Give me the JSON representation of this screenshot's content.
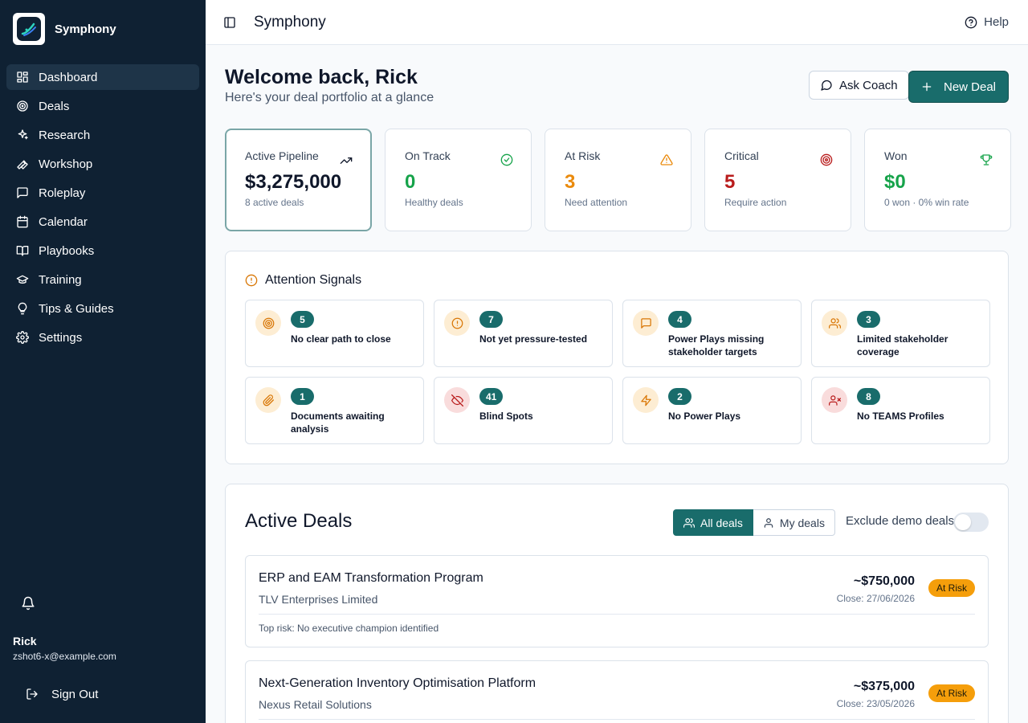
{
  "app": {
    "name": "Symphony"
  },
  "sidebar": {
    "items": [
      {
        "label": "Dashboard",
        "icon": "dashboard-icon"
      },
      {
        "label": "Deals",
        "icon": "target-icon"
      },
      {
        "label": "Research",
        "icon": "sparkles-icon"
      },
      {
        "label": "Workshop",
        "icon": "wrench-icon"
      },
      {
        "label": "Roleplay",
        "icon": "message-square-icon"
      },
      {
        "label": "Calendar",
        "icon": "calendar-icon"
      },
      {
        "label": "Playbooks",
        "icon": "book-icon"
      },
      {
        "label": "Training",
        "icon": "graduation-cap-icon"
      },
      {
        "label": "Tips & Guides",
        "icon": "lightbulb-icon"
      },
      {
        "label": "Settings",
        "icon": "gear-icon"
      }
    ],
    "active_index": 0,
    "user": {
      "name": "Rick",
      "email": "zshot6-x@example.com"
    },
    "signout_label": "Sign Out"
  },
  "topbar": {
    "title": "Symphony",
    "help_label": "Help"
  },
  "welcome": {
    "title": "Welcome back, Rick",
    "subtitle": "Here's your deal portfolio at a glance",
    "ask_coach_label": "Ask Coach",
    "new_deal_label": "New Deal"
  },
  "stats": [
    {
      "label": "Active Pipeline",
      "value": "$3,275,000",
      "sub": "8 active deals",
      "icon": "trending-up-icon",
      "color": "#0f172a"
    },
    {
      "label": "On Track",
      "value": "0",
      "sub": "Healthy deals",
      "icon": "check-circle-icon",
      "color": "#16a34a"
    },
    {
      "label": "At Risk",
      "value": "3",
      "sub": "Need attention",
      "icon": "warning-icon",
      "color": "#ea8a0c"
    },
    {
      "label": "Critical",
      "value": "5",
      "sub": "Require action",
      "icon": "target-icon",
      "color": "#b91c1c"
    },
    {
      "label": "Won",
      "value": "$0",
      "sub": "0 won · 0% win rate",
      "icon": "trophy-icon",
      "color": "#16a34a"
    }
  ],
  "signals": {
    "title": "Attention Signals",
    "items": [
      {
        "count": "5",
        "label": "No clear path to close",
        "icon": "target-icon",
        "tone": "amber"
      },
      {
        "count": "7",
        "label": "Not yet pressure-tested",
        "icon": "alert-circle-icon",
        "tone": "amber"
      },
      {
        "count": "4",
        "label": "Power Plays missing stakeholder targets",
        "icon": "message-square-icon",
        "tone": "amber"
      },
      {
        "count": "3",
        "label": "Limited stakeholder coverage",
        "icon": "users-icon",
        "tone": "amber"
      },
      {
        "count": "1",
        "label": "Documents awaiting analysis",
        "icon": "paperclip-icon",
        "tone": "amber"
      },
      {
        "count": "41",
        "label": "Blind Spots",
        "icon": "eye-off-icon",
        "tone": "red"
      },
      {
        "count": "2",
        "label": "No Power Plays",
        "icon": "zap-icon",
        "tone": "amber"
      },
      {
        "count": "8",
        "label": "No TEAMS Profiles",
        "icon": "user-x-icon",
        "tone": "red"
      }
    ]
  },
  "deals": {
    "title": "Active Deals",
    "filter_all": "All deals",
    "filter_mine": "My deals",
    "exclude_label": "Exclude demo deals",
    "list": [
      {
        "name": "ERP and EAM Transformation Program",
        "company": "TLV Enterprises Limited",
        "value": "~$750,000",
        "close": "Close: 27/06/2026",
        "status": "At Risk",
        "risk": "Top risk: No executive champion identified"
      },
      {
        "name": "Next-Generation Inventory Optimisation Platform",
        "company": "Nexus Retail Solutions",
        "value": "~$375,000",
        "close": "Close: 23/05/2026",
        "status": "At Risk",
        "risk": ""
      }
    ]
  },
  "colors": {
    "sidebar": "#0f2133",
    "accent": "#196c6b",
    "at_risk": "#f59e0b"
  }
}
